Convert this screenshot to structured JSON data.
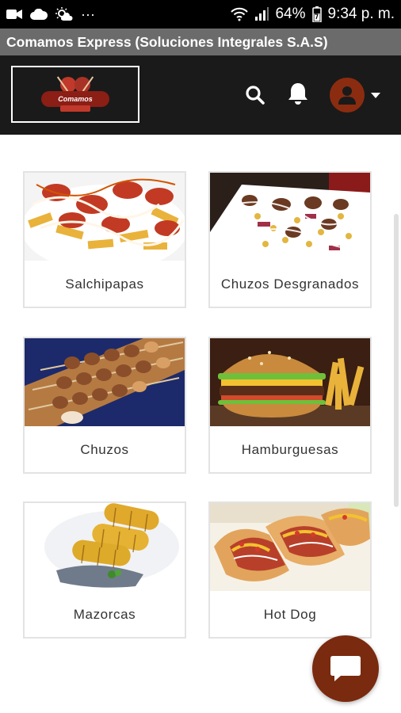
{
  "status_bar": {
    "battery": "64%",
    "time": "9:34 p. m.",
    "more": "···"
  },
  "app": {
    "title": "Comamos Express (Soluciones Integrales S.A.S)"
  },
  "header": {
    "logo_text": "Comamos",
    "icons": [
      "search-icon",
      "bell-icon",
      "user-icon",
      "caret-down-icon"
    ]
  },
  "categories": [
    {
      "label": "Salchipapas"
    },
    {
      "label": "Chuzos Desgranados"
    },
    {
      "label": "Chuzos"
    },
    {
      "label": "Hamburguesas"
    },
    {
      "label": "Mazorcas"
    },
    {
      "label": "Hot Dog"
    }
  ],
  "colors": {
    "header_bg": "#1a1a1a",
    "title_bar_bg": "#6b6b6b",
    "accent": "#7a2a0e"
  },
  "chat": {
    "icon": "chat-icon"
  }
}
